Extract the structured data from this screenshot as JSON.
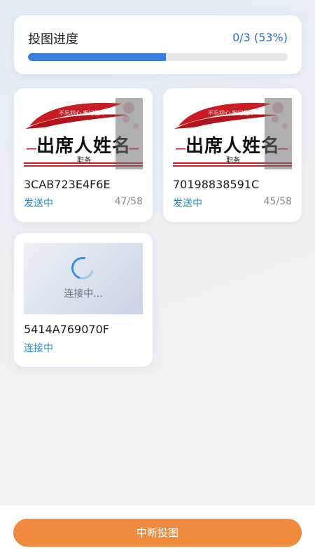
{
  "progress": {
    "title": "投图进度",
    "count": "0/3 (53%)",
    "fraction": 0.53
  },
  "devices": [
    {
      "id": "3CAB723E4F6E",
      "status": "发送中",
      "progress": "47/58",
      "thumb": {
        "banner": "不忘初心 牢记使命",
        "name": "出席人姓名",
        "title": "职务"
      }
    },
    {
      "id": "70198838591C",
      "status": "发送中",
      "progress": "45/58",
      "thumb": {
        "banner": "不忘初心 牢记使命",
        "name": "出席人姓名",
        "title": "职务"
      }
    },
    {
      "id": "5414A769070F",
      "status": "连接中",
      "connecting_text": "连接中..."
    }
  ],
  "actions": {
    "stop_label": "中断投图"
  },
  "colors": {
    "accent": "#3a7de0",
    "status": "#2587c7",
    "stop_button": "#f08a3c"
  }
}
